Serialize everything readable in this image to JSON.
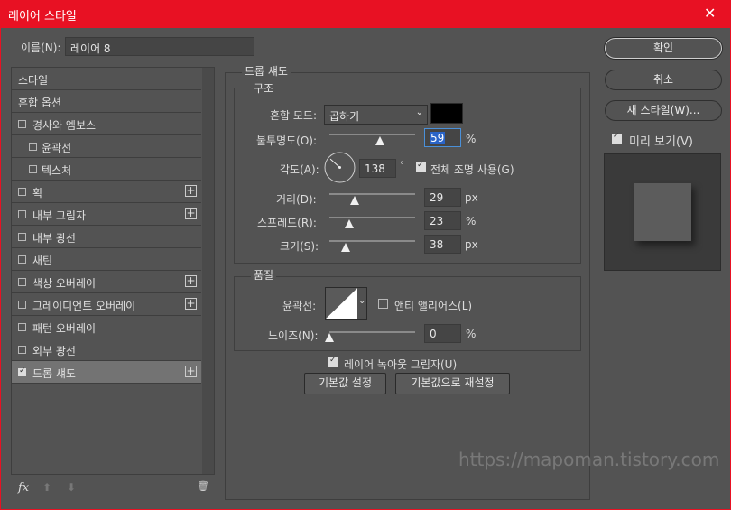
{
  "window": {
    "title": "레이어 스타일",
    "close_glyph": "✕"
  },
  "name_field": {
    "label": "이름(N):",
    "value": "레이어 8"
  },
  "sidebar": {
    "items": [
      {
        "label": "스타일",
        "checkbox": null,
        "add": false,
        "indent": false,
        "selected": false
      },
      {
        "label": "혼합 옵션",
        "checkbox": null,
        "add": false,
        "indent": false,
        "selected": false
      },
      {
        "label": "경사와 엠보스",
        "checkbox": false,
        "add": false,
        "indent": false,
        "selected": false
      },
      {
        "label": "윤곽선",
        "checkbox": false,
        "add": false,
        "indent": true,
        "selected": false
      },
      {
        "label": "텍스처",
        "checkbox": false,
        "add": false,
        "indent": true,
        "selected": false
      },
      {
        "label": "획",
        "checkbox": false,
        "add": true,
        "indent": false,
        "selected": false
      },
      {
        "label": "내부 그림자",
        "checkbox": false,
        "add": true,
        "indent": false,
        "selected": false
      },
      {
        "label": "내부 광선",
        "checkbox": false,
        "add": false,
        "indent": false,
        "selected": false
      },
      {
        "label": "새틴",
        "checkbox": false,
        "add": false,
        "indent": false,
        "selected": false
      },
      {
        "label": "색상 오버레이",
        "checkbox": false,
        "add": true,
        "indent": false,
        "selected": false
      },
      {
        "label": "그레이디언트 오버레이",
        "checkbox": false,
        "add": true,
        "indent": false,
        "selected": false
      },
      {
        "label": "패턴 오버레이",
        "checkbox": false,
        "add": false,
        "indent": false,
        "selected": false
      },
      {
        "label": "외부 광선",
        "checkbox": false,
        "add": false,
        "indent": false,
        "selected": false
      },
      {
        "label": "드롭 섀도",
        "checkbox": true,
        "add": true,
        "indent": false,
        "selected": true
      }
    ],
    "footer": {
      "fx": "fx",
      "up": "⬆",
      "down": "⬇",
      "trash": "🗑"
    }
  },
  "panel": {
    "title": "드롭 섀도",
    "structure": {
      "legend": "구조",
      "blend_mode": {
        "label": "혼합 모드:",
        "value": "곱하기",
        "color": "#000000"
      },
      "opacity": {
        "label": "불투명도(O):",
        "value": "59",
        "unit": "%",
        "fraction": 0.59
      },
      "angle": {
        "label": "각도(A):",
        "value": "138",
        "unit": "°",
        "degrees": 138,
        "global_label": "전체 조명 사용(G)",
        "global": true
      },
      "distance": {
        "label": "거리(D):",
        "value": "29",
        "unit": "px",
        "fraction": 0.29
      },
      "spread": {
        "label": "스프레드(R):",
        "value": "23",
        "unit": "%",
        "fraction": 0.23
      },
      "size": {
        "label": "크기(S):",
        "value": "38",
        "unit": "px",
        "fraction": 0.19
      }
    },
    "quality": {
      "legend": "품질",
      "contour_label": "윤곽선:",
      "antialias_label": "앤티 앨리어스(L)",
      "antialias": false,
      "noise": {
        "label": "노이즈(N):",
        "value": "0",
        "unit": "%",
        "fraction": 0
      }
    },
    "knockout": {
      "label": "레이어 녹아웃 그림자(U)",
      "checked": true
    },
    "buttons": {
      "make_default": "기본값 설정",
      "reset_default": "기본값으로 재설정"
    }
  },
  "right": {
    "ok": "확인",
    "cancel": "취소",
    "new_style": "새 스타일(W)...",
    "preview_label": "미리 보기(V)",
    "preview": true
  },
  "watermark": "https://mapoman.tistory.com"
}
